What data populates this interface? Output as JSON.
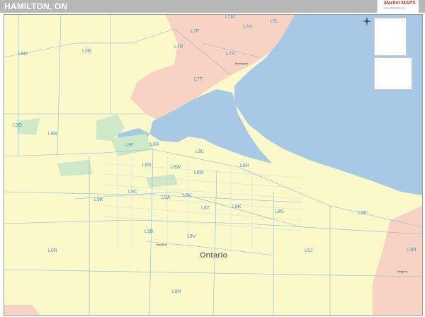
{
  "title": "HAMILTON, ON",
  "logo": {
    "brand": "Market MAPS",
    "tagline": "www.marketmaps.com"
  },
  "region_label": "Ontario",
  "city_labels": [
    {
      "name": "Hamilton"
    },
    {
      "name": "Burlington"
    },
    {
      "name": "Niagara"
    }
  ],
  "postal_codes": [
    "L7M",
    "L7N",
    "L7L",
    "L7P",
    "L7R",
    "L7S",
    "L7T",
    "L9H",
    "L0R",
    "L9G",
    "L8N",
    "L8P",
    "L8R",
    "L8S",
    "L8L",
    "L8H",
    "L8M",
    "L8W",
    "L9C",
    "L9K",
    "L9A",
    "L9V",
    "L8T",
    "L8K",
    "L8G",
    "L8E",
    "L8J",
    "L0R",
    "L8V",
    "L9B",
    "L3M",
    "L8R"
  ],
  "colors": {
    "land": "#fbf8c9",
    "water": "#a8c9e5",
    "pink_region": "#f8d2c2",
    "green_park": "#cfe8c7",
    "road": "#7fbce0",
    "border": "#5ba3d0"
  },
  "icons": [
    "compass-icon"
  ]
}
